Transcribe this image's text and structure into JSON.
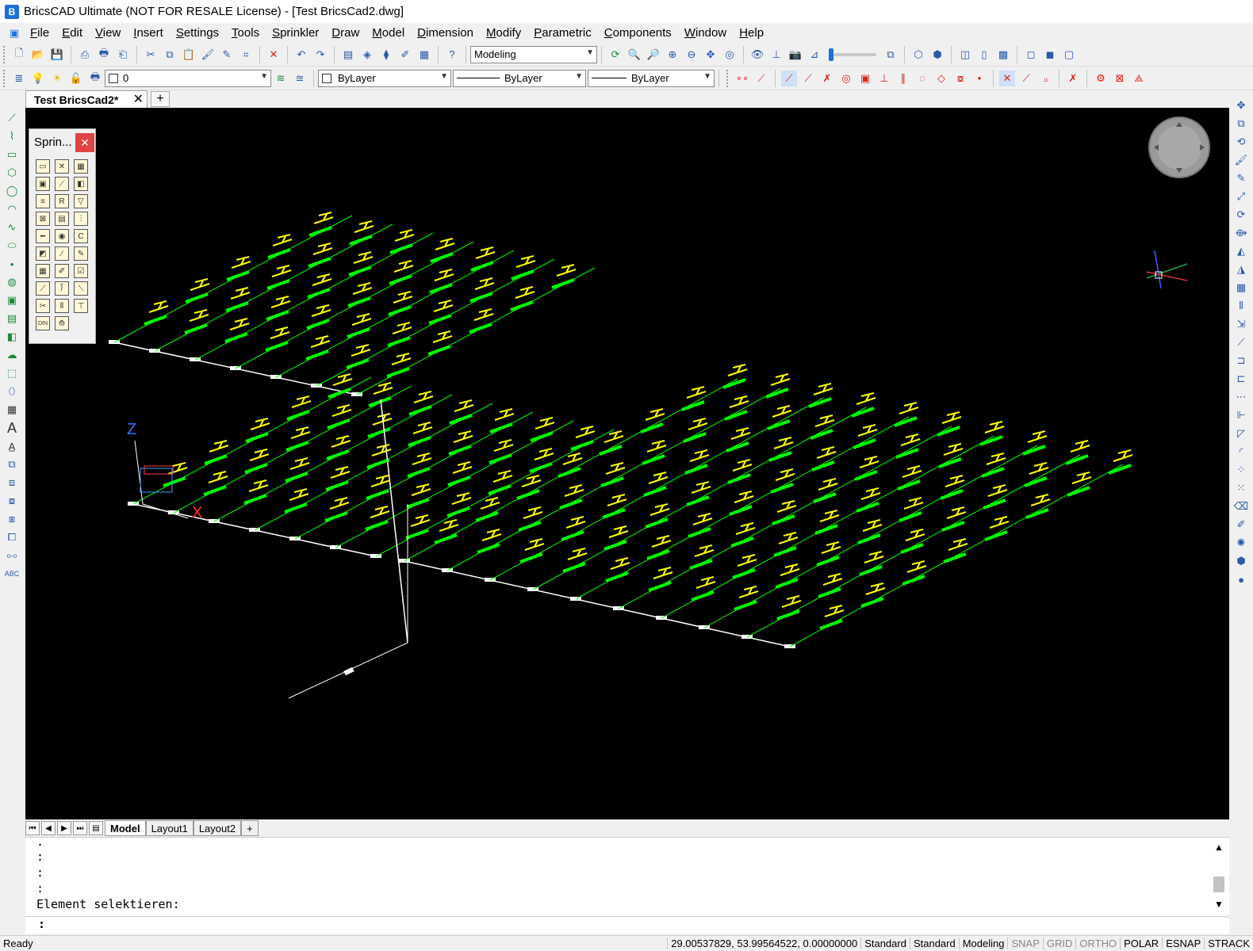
{
  "window": {
    "title": "BricsCAD Ultimate (NOT FOR RESALE License) - [Test BricsCad2.dwg]"
  },
  "menu": [
    "File",
    "Edit",
    "View",
    "Insert",
    "Settings",
    "Tools",
    "Sprinkler",
    "Draw",
    "Model",
    "Dimension",
    "Modify",
    "Parametric",
    "Components",
    "Window",
    "Help"
  ],
  "toolbar": {
    "workspace": "Modeling",
    "layer": "0",
    "color": "ByLayer",
    "linetype": "ByLayer",
    "lineweight": "ByLayer"
  },
  "doc_tab": {
    "label": "Test BricsCad2*",
    "close": "✕",
    "new": "+"
  },
  "sprinkler_panel": {
    "title": "Sprin...",
    "close": "✕"
  },
  "viewport": {
    "axis_z": "Z",
    "axis_x": "X",
    "pipe_color": "#00ff00",
    "head_color": "#ffff00",
    "line_color": "#ffffff"
  },
  "layout_tabs": [
    "Model",
    "Layout1",
    "Layout2",
    "+"
  ],
  "command": {
    "history": [
      ".",
      ":",
      ":",
      ":",
      "Element selektieren:"
    ],
    "prompt": ":"
  },
  "status": {
    "ready": "Ready",
    "coords": "29.00537829, 53.99564522, 0.00000000",
    "items": [
      {
        "label": "Standard",
        "on": true
      },
      {
        "label": "Standard",
        "on": true
      },
      {
        "label": "Modeling",
        "on": true
      },
      {
        "label": "SNAP",
        "on": false
      },
      {
        "label": "GRID",
        "on": false
      },
      {
        "label": "ORTHO",
        "on": false
      },
      {
        "label": "POLAR",
        "on": true
      },
      {
        "label": "ESNAP",
        "on": true
      },
      {
        "label": "STRACK",
        "on": true
      }
    ]
  }
}
